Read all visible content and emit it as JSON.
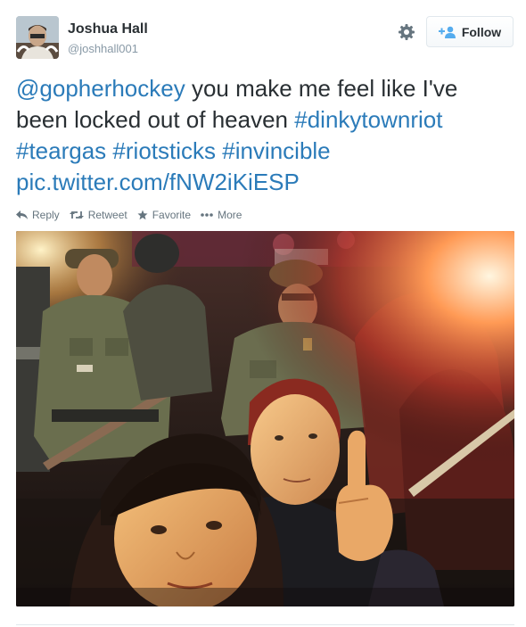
{
  "user": {
    "display_name": "Joshua Hall",
    "username": "@joshhall001",
    "avatar_icon": "user-avatar"
  },
  "header": {
    "settings_icon": "gear-icon",
    "follow_label": "Follow",
    "follow_icon": "add-user-icon"
  },
  "tweet": {
    "mention": "@gopherhockey",
    "text_1": " you make me feel like I've been locked out of heaven ",
    "hashtags": [
      "#dinkytownriot",
      "#teargas",
      "#riotsticks",
      "#invincible"
    ],
    "link": "pic.twitter.com/fNW2iKiESP"
  },
  "actions": [
    {
      "label": "Reply",
      "icon": "reply-icon"
    },
    {
      "label": "Retweet",
      "icon": "retweet-icon"
    },
    {
      "label": "Favorite",
      "icon": "star-icon"
    },
    {
      "label": "More",
      "icon": "more-icon"
    }
  ],
  "colors": {
    "link": "#2b7bb9",
    "text": "#292f33",
    "muted": "#8899a6",
    "action": "#66757f",
    "border": "#e1e8ed"
  }
}
